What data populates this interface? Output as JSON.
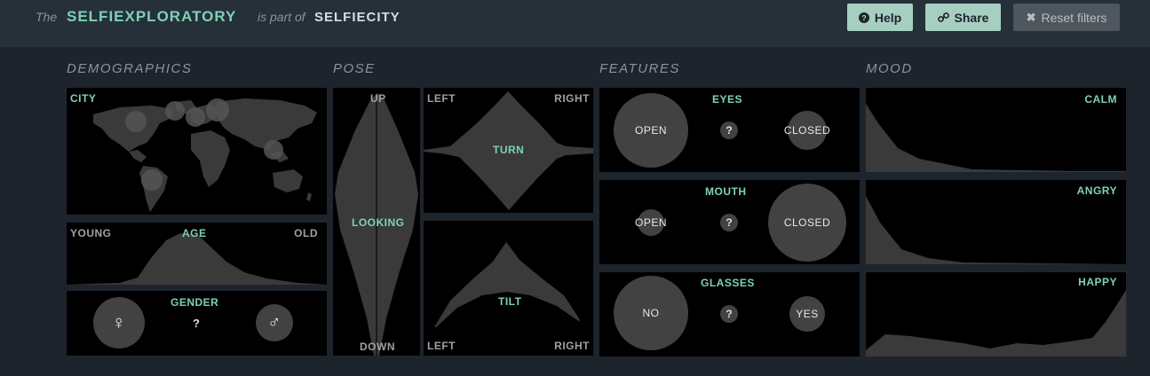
{
  "header": {
    "prefix": "The",
    "app_name": "SELFIEXPLORATORY",
    "middle": "is part of",
    "parent": "SELFIECITY",
    "buttons": {
      "help": "Help",
      "share": "Share",
      "reset": "Reset filters"
    },
    "icons": {
      "help": "question-circle-icon",
      "share": "link-icon",
      "reset": "close-icon"
    }
  },
  "sections": {
    "demographics": "DEMOGRAPHICS",
    "pose": "POSE",
    "features": "FEATURES",
    "mood": "MOOD"
  },
  "demographics": {
    "city": "CITY",
    "age": {
      "title": "AGE",
      "left": "YOUNG",
      "right": "OLD"
    },
    "gender": {
      "title": "GENDER",
      "female": "♀",
      "unknown": "?",
      "male": "♂"
    }
  },
  "pose": {
    "looking": {
      "top": "UP",
      "center": "LOOKING",
      "bottom": "DOWN"
    },
    "turn": {
      "left": "LEFT",
      "right": "RIGHT",
      "center": "TURN"
    },
    "tilt": {
      "left": "LEFT",
      "right": "RIGHT",
      "center": "TILT"
    }
  },
  "features": {
    "eyes": {
      "title": "EYES",
      "open": "OPEN",
      "unknown": "?",
      "closed": "CLOSED"
    },
    "mouth": {
      "title": "MOUTH",
      "open": "OPEN",
      "unknown": "?",
      "closed": "CLOSED"
    },
    "glasses": {
      "title": "GLASSES",
      "no": "NO",
      "unknown": "?",
      "yes": "YES"
    }
  },
  "mood": {
    "calm": "CALM",
    "angry": "ANGRY",
    "happy": "HAPPY"
  },
  "colors": {
    "accent": "#7fd1b6",
    "button_light": "#a6cfc1",
    "shape_fill": "#424242"
  }
}
